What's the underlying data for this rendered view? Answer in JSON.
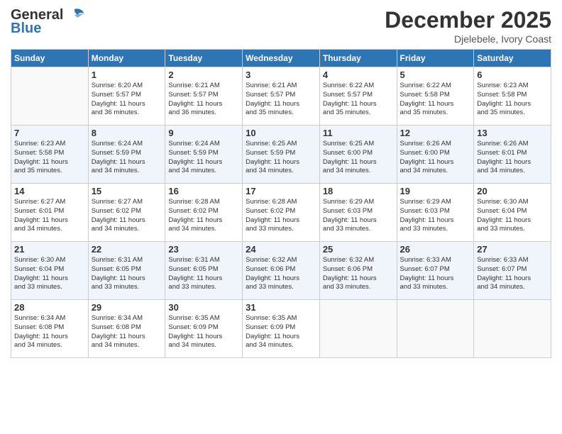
{
  "logo": {
    "text_general": "General",
    "text_blue": "Blue"
  },
  "title": "December 2025",
  "subtitle": "Djelebele, Ivory Coast",
  "weekdays": [
    "Sunday",
    "Monday",
    "Tuesday",
    "Wednesday",
    "Thursday",
    "Friday",
    "Saturday"
  ],
  "weeks": [
    [
      {
        "day": "",
        "info": ""
      },
      {
        "day": "1",
        "info": "Sunrise: 6:20 AM\nSunset: 5:57 PM\nDaylight: 11 hours\nand 36 minutes."
      },
      {
        "day": "2",
        "info": "Sunrise: 6:21 AM\nSunset: 5:57 PM\nDaylight: 11 hours\nand 36 minutes."
      },
      {
        "day": "3",
        "info": "Sunrise: 6:21 AM\nSunset: 5:57 PM\nDaylight: 11 hours\nand 35 minutes."
      },
      {
        "day": "4",
        "info": "Sunrise: 6:22 AM\nSunset: 5:57 PM\nDaylight: 11 hours\nand 35 minutes."
      },
      {
        "day": "5",
        "info": "Sunrise: 6:22 AM\nSunset: 5:58 PM\nDaylight: 11 hours\nand 35 minutes."
      },
      {
        "day": "6",
        "info": "Sunrise: 6:23 AM\nSunset: 5:58 PM\nDaylight: 11 hours\nand 35 minutes."
      }
    ],
    [
      {
        "day": "7",
        "info": "Sunrise: 6:23 AM\nSunset: 5:58 PM\nDaylight: 11 hours\nand 35 minutes."
      },
      {
        "day": "8",
        "info": "Sunrise: 6:24 AM\nSunset: 5:59 PM\nDaylight: 11 hours\nand 34 minutes."
      },
      {
        "day": "9",
        "info": "Sunrise: 6:24 AM\nSunset: 5:59 PM\nDaylight: 11 hours\nand 34 minutes."
      },
      {
        "day": "10",
        "info": "Sunrise: 6:25 AM\nSunset: 5:59 PM\nDaylight: 11 hours\nand 34 minutes."
      },
      {
        "day": "11",
        "info": "Sunrise: 6:25 AM\nSunset: 6:00 PM\nDaylight: 11 hours\nand 34 minutes."
      },
      {
        "day": "12",
        "info": "Sunrise: 6:26 AM\nSunset: 6:00 PM\nDaylight: 11 hours\nand 34 minutes."
      },
      {
        "day": "13",
        "info": "Sunrise: 6:26 AM\nSunset: 6:01 PM\nDaylight: 11 hours\nand 34 minutes."
      }
    ],
    [
      {
        "day": "14",
        "info": "Sunrise: 6:27 AM\nSunset: 6:01 PM\nDaylight: 11 hours\nand 34 minutes."
      },
      {
        "day": "15",
        "info": "Sunrise: 6:27 AM\nSunset: 6:02 PM\nDaylight: 11 hours\nand 34 minutes."
      },
      {
        "day": "16",
        "info": "Sunrise: 6:28 AM\nSunset: 6:02 PM\nDaylight: 11 hours\nand 34 minutes."
      },
      {
        "day": "17",
        "info": "Sunrise: 6:28 AM\nSunset: 6:02 PM\nDaylight: 11 hours\nand 33 minutes."
      },
      {
        "day": "18",
        "info": "Sunrise: 6:29 AM\nSunset: 6:03 PM\nDaylight: 11 hours\nand 33 minutes."
      },
      {
        "day": "19",
        "info": "Sunrise: 6:29 AM\nSunset: 6:03 PM\nDaylight: 11 hours\nand 33 minutes."
      },
      {
        "day": "20",
        "info": "Sunrise: 6:30 AM\nSunset: 6:04 PM\nDaylight: 11 hours\nand 33 minutes."
      }
    ],
    [
      {
        "day": "21",
        "info": "Sunrise: 6:30 AM\nSunset: 6:04 PM\nDaylight: 11 hours\nand 33 minutes."
      },
      {
        "day": "22",
        "info": "Sunrise: 6:31 AM\nSunset: 6:05 PM\nDaylight: 11 hours\nand 33 minutes."
      },
      {
        "day": "23",
        "info": "Sunrise: 6:31 AM\nSunset: 6:05 PM\nDaylight: 11 hours\nand 33 minutes."
      },
      {
        "day": "24",
        "info": "Sunrise: 6:32 AM\nSunset: 6:06 PM\nDaylight: 11 hours\nand 33 minutes."
      },
      {
        "day": "25",
        "info": "Sunrise: 6:32 AM\nSunset: 6:06 PM\nDaylight: 11 hours\nand 33 minutes."
      },
      {
        "day": "26",
        "info": "Sunrise: 6:33 AM\nSunset: 6:07 PM\nDaylight: 11 hours\nand 33 minutes."
      },
      {
        "day": "27",
        "info": "Sunrise: 6:33 AM\nSunset: 6:07 PM\nDaylight: 11 hours\nand 34 minutes."
      }
    ],
    [
      {
        "day": "28",
        "info": "Sunrise: 6:34 AM\nSunset: 6:08 PM\nDaylight: 11 hours\nand 34 minutes."
      },
      {
        "day": "29",
        "info": "Sunrise: 6:34 AM\nSunset: 6:08 PM\nDaylight: 11 hours\nand 34 minutes."
      },
      {
        "day": "30",
        "info": "Sunrise: 6:35 AM\nSunset: 6:09 PM\nDaylight: 11 hours\nand 34 minutes."
      },
      {
        "day": "31",
        "info": "Sunrise: 6:35 AM\nSunset: 6:09 PM\nDaylight: 11 hours\nand 34 minutes."
      },
      {
        "day": "",
        "info": ""
      },
      {
        "day": "",
        "info": ""
      },
      {
        "day": "",
        "info": ""
      }
    ]
  ]
}
